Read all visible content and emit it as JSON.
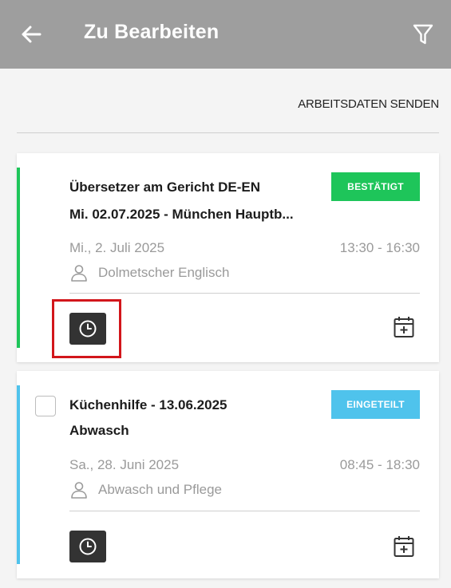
{
  "header": {
    "title": "Zu Bearbeiten",
    "back_icon": "arrow-left-icon",
    "filter_icon": "filter-icon",
    "background": "#9e9e9e"
  },
  "actions": {
    "send_work_data": "ARBEITSDATEN SENDEN"
  },
  "cards": [
    {
      "title_line1": "Übersetzer am Gericht DE-EN",
      "title_line2": "Mi. 02.07.2025 - München Hauptb...",
      "status": "BESTÄTIGT",
      "status_color": "#1ec55a",
      "stripe_color": "#1ec55a",
      "date": "Mi., 2. Juli 2025",
      "time": "13:30 - 16:30",
      "role": "Dolmetscher Englisch",
      "has_checkbox": false,
      "clock_highlighted": true
    },
    {
      "title_line1": "Küchenhilfe - 13.06.2025",
      "title_line2": "Abwasch",
      "status": "EINGETEILT",
      "status_color": "#4fc3ec",
      "stripe_color": "#4fc3ec",
      "date": "Sa., 28. Juni 2025",
      "time": "08:45 - 18:30",
      "role": "Abwasch und Pflege",
      "has_checkbox": true,
      "clock_highlighted": false
    }
  ]
}
